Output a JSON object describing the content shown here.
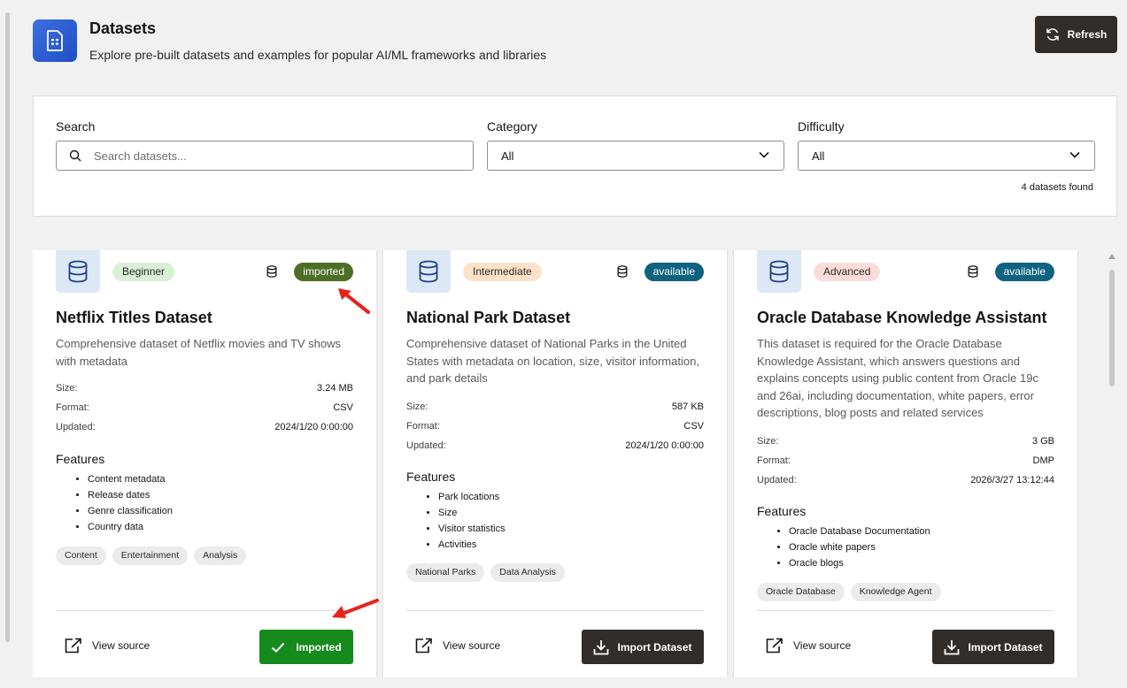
{
  "header": {
    "title": "Datasets",
    "subtitle": "Explore pre-built datasets and examples for popular AI/ML frameworks and libraries",
    "refresh_label": "Refresh"
  },
  "filters": {
    "search_label": "Search",
    "search_placeholder": "Search datasets...",
    "category_label": "Category",
    "category_value": "All",
    "difficulty_label": "Difficulty",
    "difficulty_value": "All",
    "results_count": "4 datasets found"
  },
  "labels": {
    "size": "Size:",
    "format": "Format:",
    "updated": "Updated:",
    "features": "Features",
    "view_source": "View source",
    "import_dataset": "Import Dataset",
    "imported_button": "Imported"
  },
  "cards": [
    {
      "difficulty": "Beginner",
      "status": "imported",
      "title": "Netflix Titles Dataset",
      "description": "Comprehensive dataset of Netflix movies and TV shows with metadata",
      "size": "3.24 MB",
      "format": "CSV",
      "updated": "2024/1/20 0:00:00",
      "features": [
        "Content metadata",
        "Release dates",
        "Genre classification",
        "Country data"
      ],
      "tags": [
        "Content",
        "Entertainment",
        "Analysis"
      ]
    },
    {
      "difficulty": "Intermediate",
      "status": "available",
      "title": "National Park Dataset",
      "description": "Comprehensive dataset of National Parks in the United States with metadata on location, size, visitor information, and park details",
      "size": "587 KB",
      "format": "CSV",
      "updated": "2024/1/20 0:00:00",
      "features": [
        "Park locations",
        "Size",
        "Visitor statistics",
        "Activities"
      ],
      "tags": [
        "National Parks",
        "Data Analysis"
      ]
    },
    {
      "difficulty": "Advanced",
      "status": "available",
      "title": "Oracle Database Knowledge Assistant",
      "description": "This dataset is required for the Oracle Database Knowledge Assistant, which answers questions and explains concepts using public content from Oracle 19c and 26ai, including documentation, white papers, error descriptions, blog posts and related services",
      "size": "3 GB",
      "format": "DMP",
      "updated": "2026/3/27 13:12:44",
      "features": [
        "Oracle Database Documentation",
        "Oracle white papers",
        "Oracle blogs"
      ],
      "tags": [
        "Oracle Database",
        "Knowledge Agent"
      ]
    }
  ],
  "colors": {
    "imported_badge": "#4c6f25",
    "available_badge": "#0f6280",
    "imported_button": "#168a1c",
    "dark_button": "#312d2a",
    "annotation_arrow": "#e8231c"
  }
}
